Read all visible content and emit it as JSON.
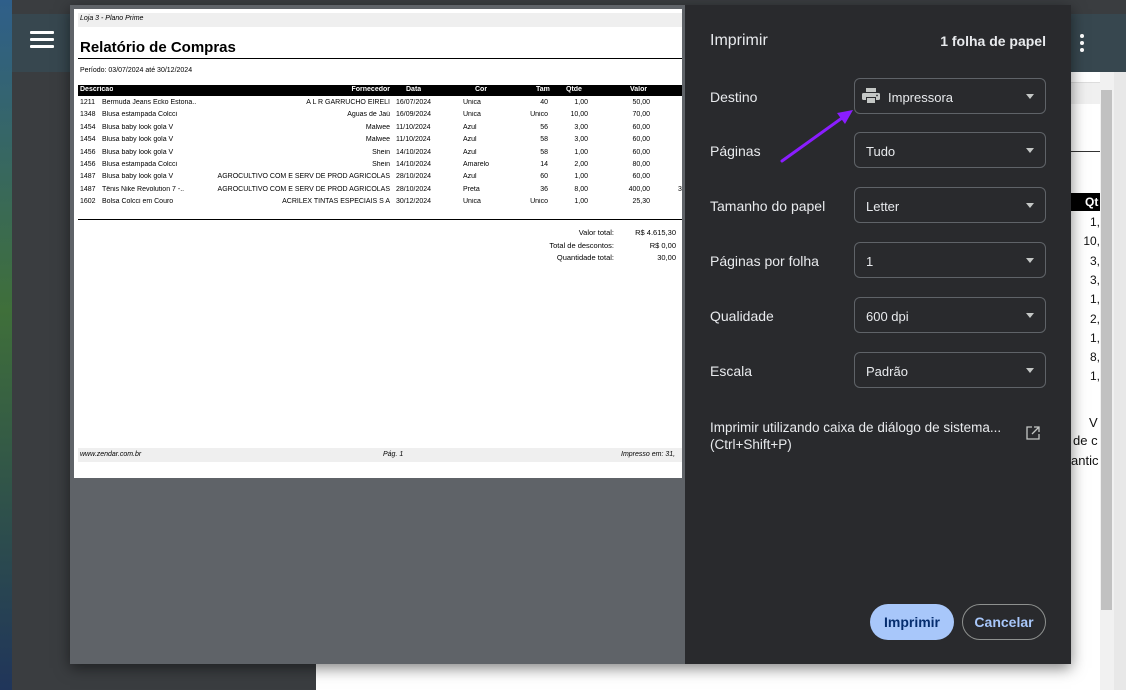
{
  "dialog": {
    "title": "Imprimir",
    "sheets": "1 folha de papel",
    "destination": {
      "label": "Destino",
      "value": "Impressora"
    },
    "pages": {
      "label": "Páginas",
      "value": "Tudo"
    },
    "paper_size": {
      "label": "Tamanho do papel",
      "value": "Letter"
    },
    "pages_per_sheet": {
      "label": "Páginas por folha",
      "value": "1"
    },
    "quality": {
      "label": "Qualidade",
      "value": "600 dpi"
    },
    "scale": {
      "label": "Escala",
      "value": "Padrão"
    },
    "system_dialog": "Imprimir utilizando caixa de diálogo de sistema... (Ctrl+Shift+P)",
    "print_button": "Imprimir",
    "cancel_button": "Cancelar",
    "accent_color": "#a8c7fa"
  },
  "preview": {
    "store": "Loja 3 - Plano Prime",
    "title": "Relatório de Compras",
    "period": "Período: 03/07/2024 até 30/12/2024",
    "columns": {
      "descricao": "Descricao",
      "fornecedor": "Fornecedor",
      "data": "Data",
      "cor": "Cor",
      "tam": "Tam",
      "qtde": "Qtde",
      "valor": "Valor"
    },
    "rows": [
      {
        "cod": "1211",
        "desc": "Bermuda Jeans Ecko Estona..",
        "forn": "A L R GARRUCHO EIRELI",
        "data": "16/07/2024",
        "cor": "Única",
        "tam": "40",
        "qtde": "1,00",
        "valor": "50,00"
      },
      {
        "cod": "1348",
        "desc": "Blusa estampada Colcci",
        "forn": "Águas de Jaú",
        "data": "16/09/2024",
        "cor": "Única",
        "tam": "Único",
        "qtde": "10,00",
        "valor": "70,00"
      },
      {
        "cod": "1454",
        "desc": "Blusa baby look gola V",
        "forn": "Malwee",
        "data": "11/10/2024",
        "cor": "Azul",
        "tam": "56",
        "qtde": "3,00",
        "valor": "60,00"
      },
      {
        "cod": "1454",
        "desc": "Blusa baby look gola V",
        "forn": "Malwee",
        "data": "11/10/2024",
        "cor": "Azul",
        "tam": "58",
        "qtde": "3,00",
        "valor": "60,00"
      },
      {
        "cod": "1456",
        "desc": "Blusa baby look gola V",
        "forn": "Shein",
        "data": "14/10/2024",
        "cor": "Azul",
        "tam": "58",
        "qtde": "1,00",
        "valor": "60,00"
      },
      {
        "cod": "1456",
        "desc": "Blusa estampada Colcci",
        "forn": "Shein",
        "data": "14/10/2024",
        "cor": "Amarelo",
        "tam": "14",
        "qtde": "2,00",
        "valor": "80,00"
      },
      {
        "cod": "1487",
        "desc": "Blusa baby look gola V",
        "forn": "AGROCULTIVO COM E SERV DE PROD AGRICOLAS",
        "data": "28/10/2024",
        "cor": "Azul",
        "tam": "60",
        "qtde": "1,00",
        "valor": "60,00"
      },
      {
        "cod": "1487",
        "desc": "Tênis Nike Revolution 7 -..",
        "forn": "AGROCULTIVO COM E SERV DE PROD AGRICOLAS",
        "data": "28/10/2024",
        "cor": "Preta",
        "tam": "36",
        "qtde": "8,00",
        "valor": "400,00",
        "extra": "3"
      },
      {
        "cod": "1602",
        "desc": "Bolsa Colcci em Couro",
        "forn": "ACRILEX TINTAS ESPECIAIS S A",
        "data": "30/12/2024",
        "cor": "Única",
        "tam": "Único",
        "qtde": "1,00",
        "valor": "25,30"
      }
    ],
    "totals": [
      {
        "label": "Valor total:",
        "value": "R$ 4.615,30"
      },
      {
        "label": "Total de descontos:",
        "value": "R$ 0,00"
      },
      {
        "label": "Quantidade total:",
        "value": "30,00"
      }
    ],
    "footer": {
      "site": "www.zendar.com.br",
      "page": "Pág. 1",
      "printed": "Impresso em: 31,"
    }
  },
  "background": {
    "qt_header": "Qt",
    "qt_values": [
      "1,",
      "10,",
      "3,",
      "3,",
      "1,",
      "2,",
      "1,",
      "8,",
      "1,"
    ],
    "side_text": [
      "V",
      "de c",
      "antic"
    ]
  }
}
